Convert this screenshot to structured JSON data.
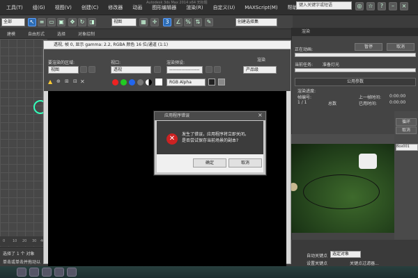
{
  "top_title": "Autodesk 3ds Max 2014 x64  无标题",
  "menu": [
    "工具(T)",
    "组(G)",
    "视图(V)",
    "创建(C)",
    "修改器",
    "动画",
    "图形编辑器",
    "渲染(R)",
    "自定义(U)",
    "MAXScript(M)",
    "帮助(H)"
  ],
  "search": {
    "placeholder": "键入关键字或短语"
  },
  "toolbar": {
    "selection_filter": "全部",
    "view_dropdown": "视图",
    "named_sel": "创建选择集"
  },
  "ribbon": [
    "建模",
    "自由形式",
    "选择",
    "对象绘制"
  ],
  "render_frame": {
    "title": "透视, 帧 0, 显示 gamma: 2.2, RGBA 颜色 16 位/通道 (1:1)",
    "area_label": "要渲染的区域:",
    "area_value": "视图",
    "viewport_label": "视口:",
    "viewport_value": "透视",
    "preset_label": "渲染预设:",
    "preset_value": "--------------------",
    "render_label": "渲染",
    "product_value": "产品级",
    "channel_value": "RGB Alpha"
  },
  "dialog": {
    "title": "应用程序错误",
    "message_line1": "发生了错误，应用程序将立即关闭。",
    "message_line2": "是否尝试保存当前场景的副本?",
    "ok": "确定",
    "cancel": "取消",
    "error_icon": "error-x-icon"
  },
  "render_panel": {
    "title": "渲染",
    "current_anim": "正在动画:",
    "pause": "暂停",
    "cancel": "取消",
    "current_task": "当前任务:",
    "task_value": "准备灯光",
    "common_params": "公用参数",
    "progress_label": "渲染进度:",
    "frame_label": "帧编号:",
    "frame_value": "1 / 1",
    "total_label": "总数",
    "last_frame_time_label": "上一帧时间:",
    "last_frame_time": "0:00:00",
    "elapsed_label": "已用时间:",
    "elapsed": "0:00:00",
    "progress_1": 0.0,
    "progress_2": 0.0
  },
  "side_col": {
    "loop": "循环",
    "cancel_sel": "取消",
    "box_label": "Box001"
  },
  "status": {
    "line1": "选择了 1 个 对象",
    "line2": "单击或单击并拖动以"
  },
  "ruler": {
    "r1": "0",
    "r2": "10",
    "r3": "20",
    "r4": "30",
    "r5": "40"
  },
  "timeline": {
    "auto_key": "自动关键点",
    "selected": "选定对象",
    "set_key": "设置关键点",
    "key_filter": "关键点过滤器..."
  },
  "colors": {
    "dialog_error": "#cc2222",
    "accent_blue": "#2d6db5"
  }
}
